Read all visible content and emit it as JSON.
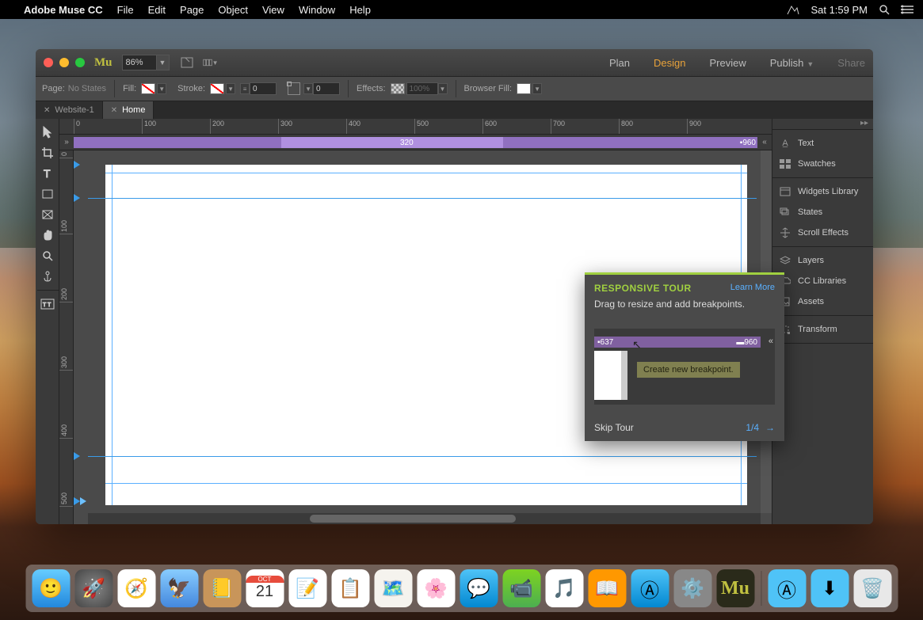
{
  "menubar": {
    "app_name": "Adobe Muse CC",
    "items": [
      "File",
      "Edit",
      "Page",
      "Object",
      "View",
      "Window",
      "Help"
    ],
    "clock": "Sat 1:59 PM"
  },
  "titlebar": {
    "zoom": "86%",
    "nav": {
      "plan": "Plan",
      "design": "Design",
      "preview": "Preview",
      "publish": "Publish",
      "share": "Share"
    }
  },
  "controlbar": {
    "page_label": "Page:",
    "page_value": "No States",
    "fill_label": "Fill:",
    "stroke_label": "Stroke:",
    "stroke_value": "0",
    "corner_value": "0",
    "effects_label": "Effects:",
    "effects_opacity": "100%",
    "browser_fill_label": "Browser Fill:"
  },
  "tabs": [
    {
      "label": "Website-1",
      "active": false
    },
    {
      "label": "Home",
      "active": true
    }
  ],
  "breakpoints": {
    "current": "320",
    "max": "960"
  },
  "ruler_h": [
    "0",
    "100",
    "200",
    "300",
    "400",
    "500",
    "600",
    "700",
    "800",
    "900"
  ],
  "ruler_v": [
    "0",
    "100",
    "200",
    "300",
    "400",
    "500"
  ],
  "panels": {
    "group1": [
      "Text",
      "Swatches"
    ],
    "group2": [
      "Widgets Library",
      "States",
      "Scroll Effects"
    ],
    "group3": [
      "Layers",
      "CC Libraries",
      "Assets"
    ],
    "group4": [
      "Transform"
    ]
  },
  "tour": {
    "title": "RESPONSIVE TOUR",
    "learn_more": "Learn More",
    "body": "Drag to resize and add breakpoints.",
    "demo_left": "637",
    "demo_right": "960",
    "tooltip": "Create new breakpoint.",
    "skip": "Skip Tour",
    "progress": "1/4"
  },
  "dock": {
    "items": [
      "finder",
      "launchpad",
      "safari",
      "mail",
      "contacts",
      "calendar",
      "notes",
      "reminders",
      "maps",
      "photos",
      "messages",
      "facetime",
      "itunes",
      "ibooks",
      "appstore",
      "preferences",
      "muse"
    ],
    "calendar_day": "21",
    "right": [
      "apps-folder",
      "downloads-folder",
      "trash"
    ]
  }
}
